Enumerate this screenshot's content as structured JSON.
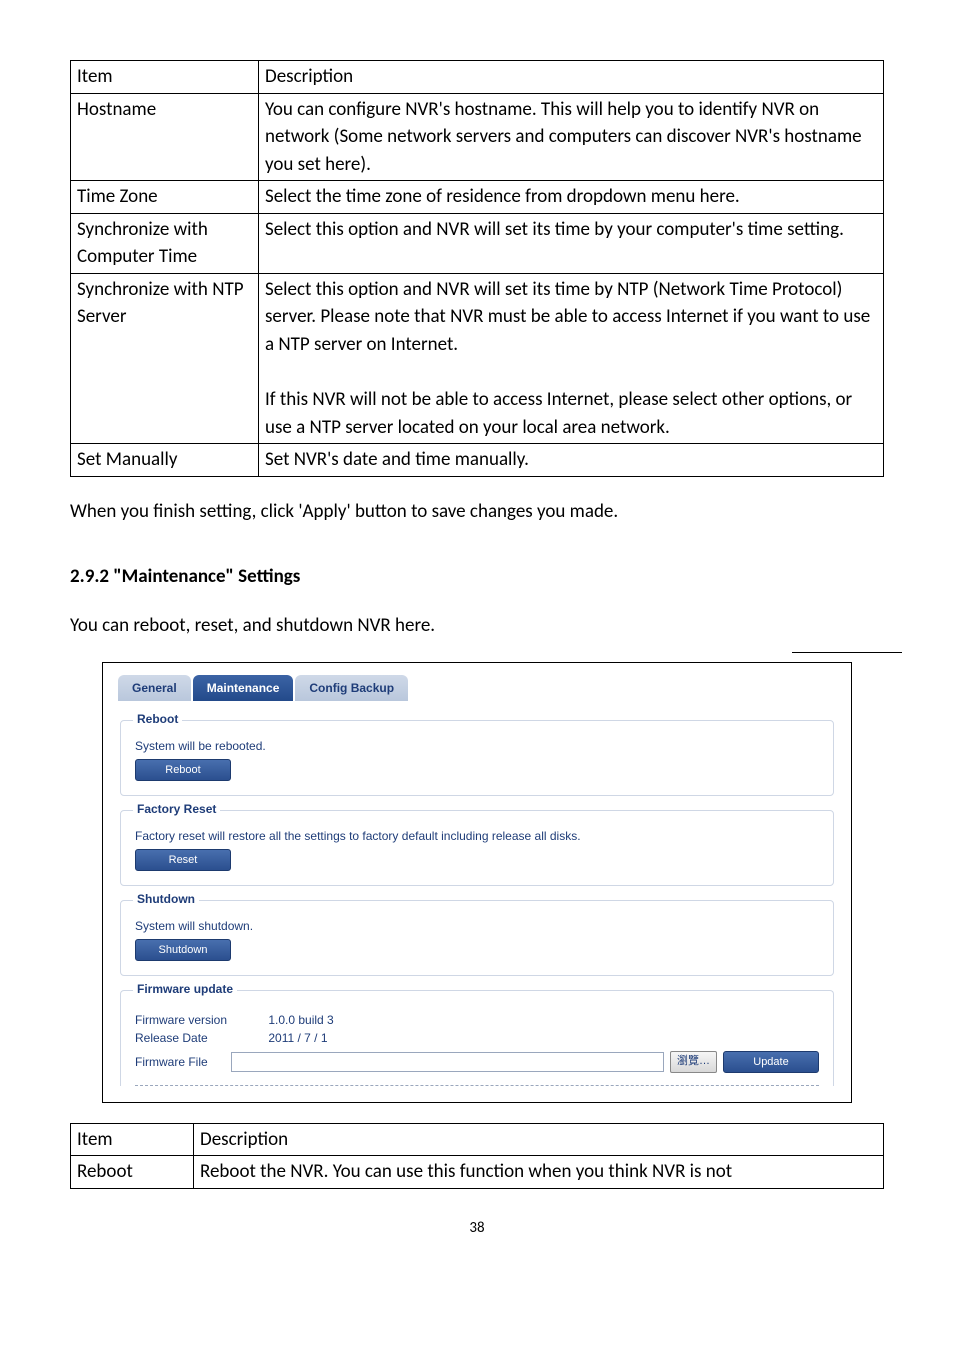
{
  "table1": {
    "headers": [
      "Item",
      "Description"
    ],
    "rows": [
      [
        "Hostname",
        "You can configure NVR's hostname. This will help you to identify NVR on network (Some network servers and computers can discover NVR's hostname you set here)."
      ],
      [
        "Time Zone",
        "Select the time zone of residence from dropdown menu here."
      ],
      [
        "Synchronize with Computer Time",
        "Select this option and NVR will set its time by your computer's time setting."
      ],
      [
        "Synchronize with NTP Server",
        "Select this option and NVR will set its time by NTP (Network Time Protocol) server. Please note that NVR must be able to access Internet if you want to use a NTP server on Internet.\n\nIf this NVR will not be able to access Internet, please select other options, or use a NTP server located on your local area network."
      ],
      [
        "Set Manually",
        "Set NVR's date and time manually."
      ]
    ]
  },
  "para1": "When you finish setting, click 'Apply' button to save changes you made.",
  "heading": "2.9.2 \"Maintenance\" Settings",
  "para2": "You can reboot, reset, and shutdown NVR here.",
  "ui": {
    "tabs": {
      "general": "General",
      "maintenance": "Maintenance",
      "config": "Config Backup"
    },
    "reboot": {
      "legend": "Reboot",
      "text": "System will be rebooted.",
      "btn": "Reboot"
    },
    "reset": {
      "legend": "Factory Reset",
      "text": "Factory reset will restore all the settings to factory default including release all disks.",
      "btn": "Reset"
    },
    "shutdown": {
      "legend": "Shutdown",
      "text": "System will shutdown.",
      "btn": "Shutdown"
    },
    "fw": {
      "legend": "Firmware update",
      "version_label": "Firmware version",
      "version_value": "1.0.0 build 3",
      "date_label": "Release Date",
      "date_value": "2011 / 7 / 1",
      "file_label": "Firmware File",
      "browse": "瀏覽…",
      "update": "Update"
    }
  },
  "table2": {
    "headers": [
      "Item",
      "Description"
    ],
    "rows": [
      [
        "Reboot",
        "Reboot the NVR. You can use this function when you think NVR is not"
      ]
    ]
  },
  "page_number": "38"
}
